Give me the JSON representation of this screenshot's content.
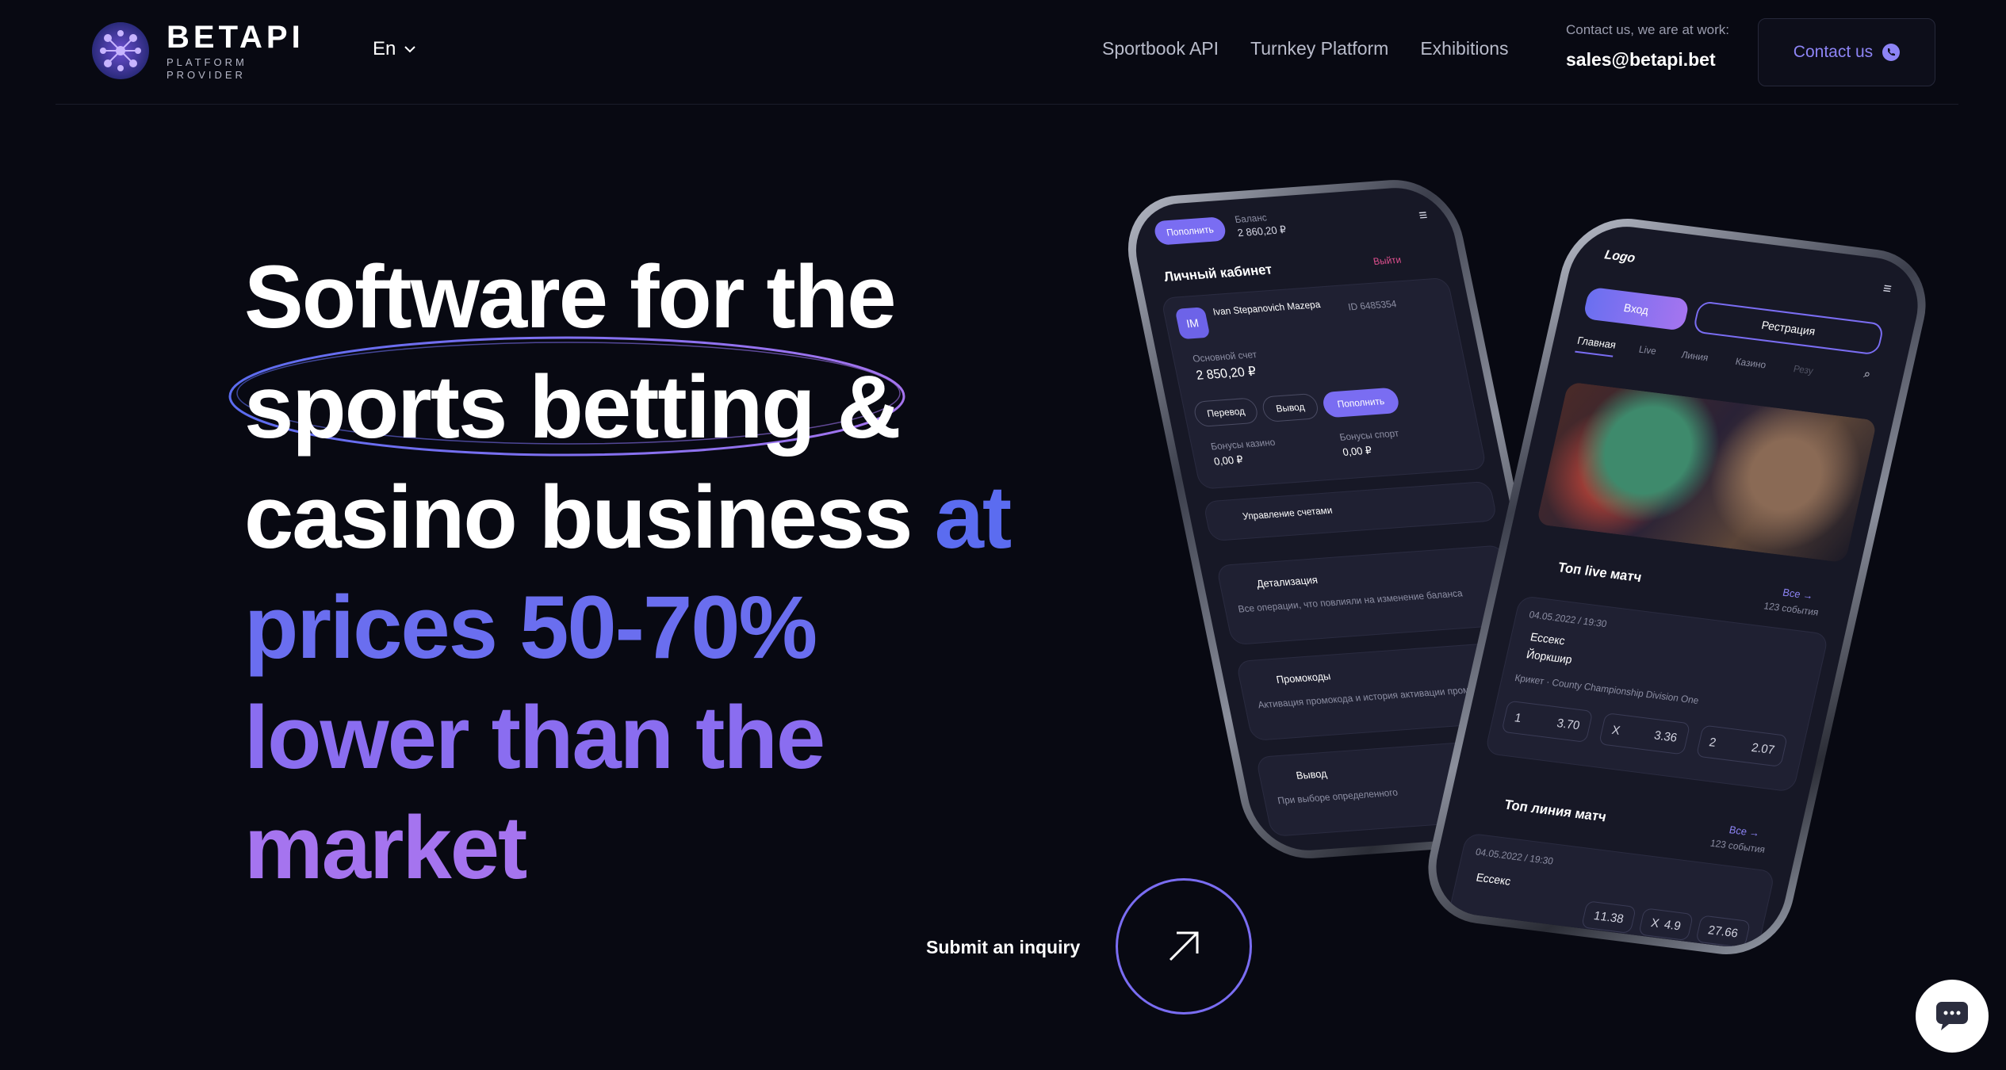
{
  "header": {
    "logo_name": "BETAPI",
    "logo_tagline": "PLATFORM PROVIDER",
    "language": "En",
    "nav": [
      "Sportbook API",
      "Turnkey Platform",
      "Exhibitions"
    ],
    "contact_hint": "Contact us, we are at work:",
    "contact_email": "sales@betapi.bet",
    "contact_button": "Contact us"
  },
  "hero": {
    "line1": "Software for the",
    "line2": "sports betting &",
    "line3_white": "casino business",
    "line3_accent": "at",
    "line4": "prices 50-70%",
    "line5": "lower than the",
    "line6": "market",
    "cta_label": "Submit an inquiry"
  },
  "phone_left": {
    "topup": "Пополнить",
    "balance_label": "Баланс",
    "balance": "2 860,20 ₽",
    "cabinet_title": "Личный кабинет",
    "logout": "Выйти",
    "avatar": "IM",
    "user_name": "Ivan Stepanovich Mazepa",
    "user_id": "ID 6485354",
    "main_account_label": "Основной счет",
    "main_account": "2 850,20 ₽",
    "btn_transfer": "Перевод",
    "btn_withdraw": "Вывод",
    "btn_topup": "Пополнить",
    "bonus_casino_label": "Бонусы казино",
    "bonus_casino": "0,00 ₽",
    "bonus_sport_label": "Бонусы спорт",
    "bonus_sport": "0,00 ₽",
    "manage_accounts": "Управление счетами",
    "details_title": "Детализация",
    "details_desc": "Все операции, что повлияли на изменение баланса",
    "promo_title": "Промокоды",
    "promo_desc": "Активация промокода и история активации промокодов",
    "withdraw_title": "Вывод",
    "withdraw_desc": "При выборе определенного"
  },
  "phone_right": {
    "logo": "Logo",
    "login": "Вход",
    "register": "Рестрация",
    "tabs": [
      "Главная",
      "Live",
      "Линия",
      "Казино",
      "Резу"
    ],
    "top_live": "Топ live матч",
    "all": "Все →",
    "events_count": "123 события",
    "match_date": "04.05.2022 / 19:30",
    "team1": "Ессекс",
    "team2": "Йоркшир",
    "league": "Крикет · County Championship Division One",
    "odds": [
      {
        "label": "1",
        "value": "3.70"
      },
      {
        "label": "X",
        "value": "3.36"
      },
      {
        "label": "2",
        "value": "2.07"
      }
    ],
    "top_line": "Топ линия матч",
    "all2": "Все →",
    "events_count2": "123 события",
    "match_date2": "04.05.2022 / 19:30",
    "team1b": "Ессекс",
    "odds2": [
      {
        "label": "1",
        "value": "1.38"
      },
      {
        "label": "X",
        "value": "4.9"
      },
      {
        "label": "2",
        "value": "7.66"
      }
    ]
  },
  "colors": {
    "background": "#080912",
    "accent_blue": "#5b6cf0",
    "accent_violet": "#a574ef",
    "button_text": "#8d84f5"
  }
}
